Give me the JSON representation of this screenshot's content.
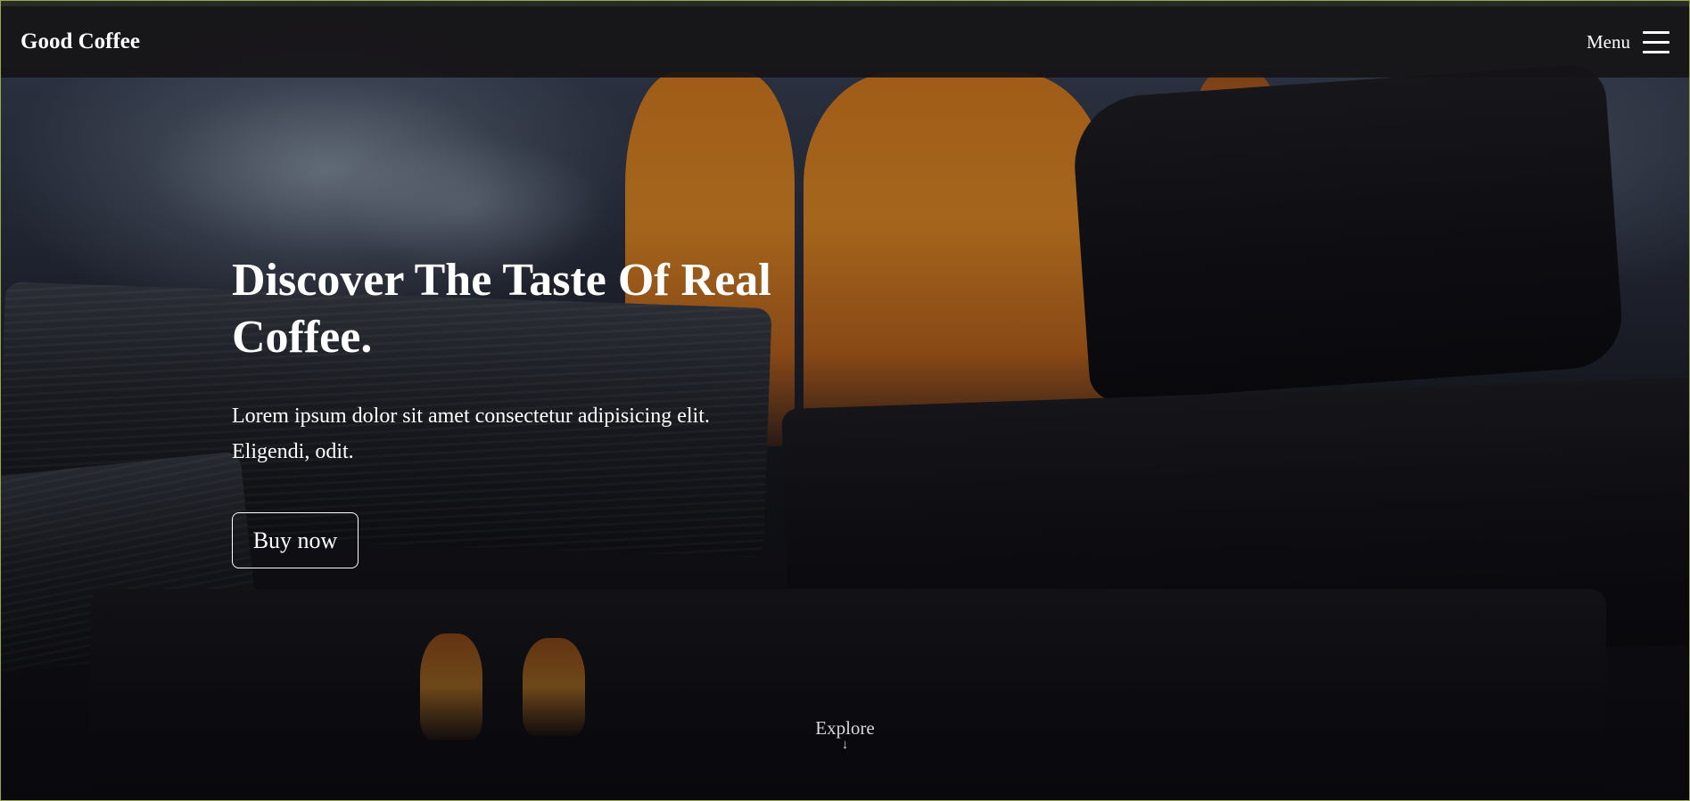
{
  "header": {
    "brand": "Good Coffee",
    "menu_label": "Menu",
    "menu_icon": "hamburger-icon"
  },
  "hero": {
    "title_line_1": "Discover The Taste Of Real",
    "title_line_2": "Coffee.",
    "text_line_1": "Lorem ipsum dolor sit amet consectetur adipisicing elit.",
    "text_line_2": "Eligendi, odit.",
    "button_label": "Buy now"
  },
  "explore": {
    "label": "Explore",
    "arrow": "↓",
    "icon": "arrow-down-icon"
  },
  "colors": {
    "text": "#ffffff",
    "header_bg": "#161416",
    "flame": "#e98e22",
    "border_accent": "#9aa84a"
  }
}
